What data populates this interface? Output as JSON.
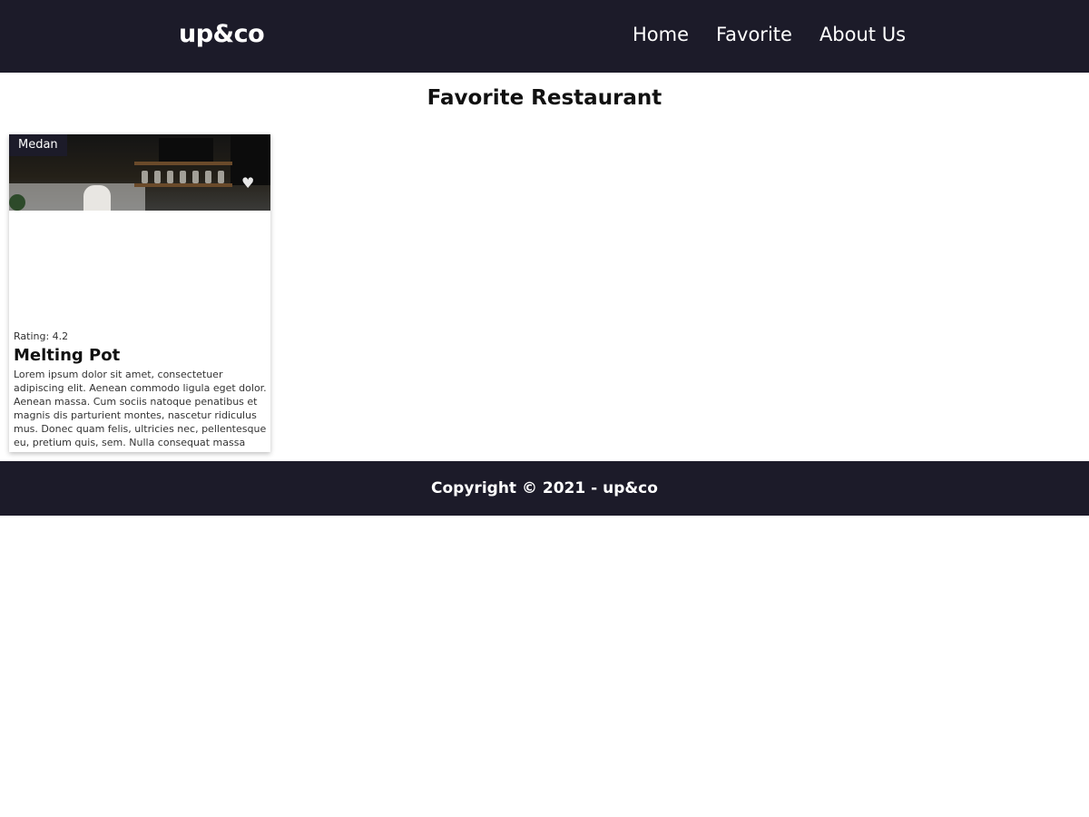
{
  "header": {
    "logo": "up&co",
    "nav": [
      {
        "label": "Home"
      },
      {
        "label": "Favorite"
      },
      {
        "label": "About Us"
      }
    ]
  },
  "main": {
    "title": "Favorite Restaurant",
    "restaurants": [
      {
        "city": "Medan",
        "rating_label": "Rating: 4.2",
        "name": "Melting Pot",
        "description": "Lorem ipsum dolor sit amet, consectetuer adipiscing elit. Aenean commodo ligula eget dolor. Aenean massa. Cum sociis natoque penatibus et magnis dis parturient montes, nascetur ridiculus mus. Donec quam felis, ultricies nec, pellentesque eu, pretium quis, sem. Nulla consequat massa quis enim. Donec pede justo, fringilla vel, aliquet nec, vulputate eget, arcu."
      }
    ]
  },
  "footer": {
    "copyright": "Copyright © 2021 - up&co"
  },
  "colors": {
    "header_bg": "#1c1b29",
    "footer_bg": "#1c1b29",
    "text": "#111111"
  },
  "icons": [
    "heart-icon"
  ]
}
